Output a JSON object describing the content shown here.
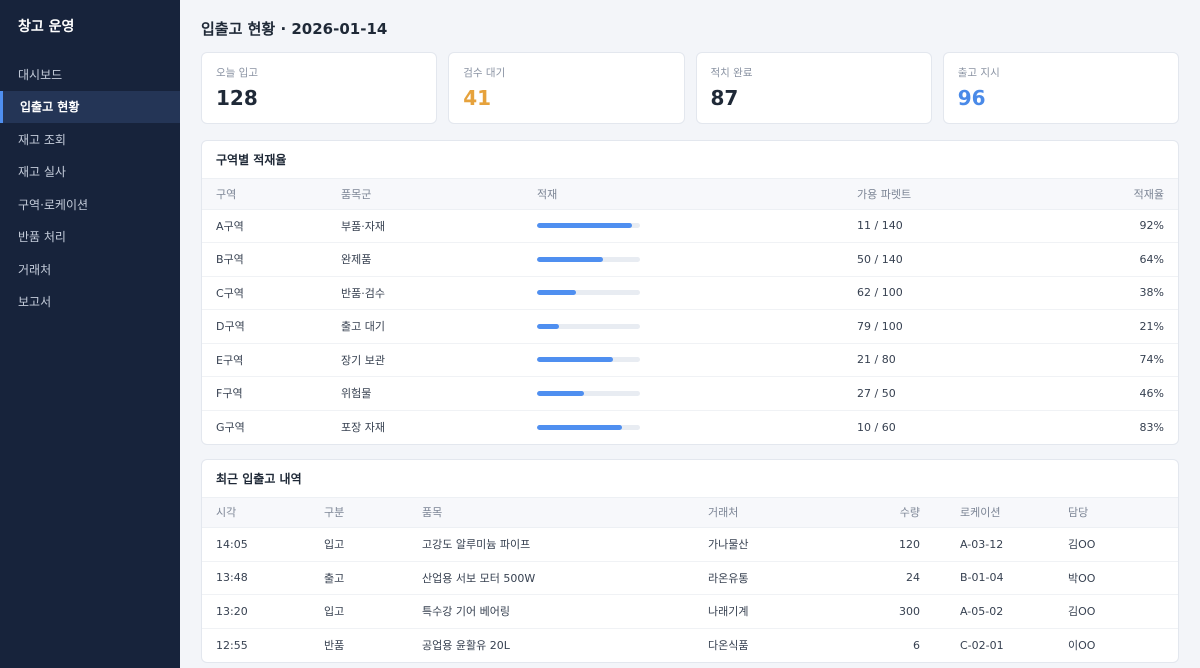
{
  "sidebar": {
    "title": "창고 운영",
    "items": [
      {
        "label": "대시보드",
        "active": false
      },
      {
        "label": "입출고 현황",
        "active": true
      },
      {
        "label": "재고 조회",
        "active": false
      },
      {
        "label": "재고 실사",
        "active": false
      },
      {
        "label": "구역·로케이션",
        "active": false
      },
      {
        "label": "반품 처리",
        "active": false
      },
      {
        "label": "거래처",
        "active": false
      },
      {
        "label": "보고서",
        "active": false
      }
    ]
  },
  "header": {
    "title": "입출고 현황 · 2026-01-14"
  },
  "cards": [
    {
      "label": "오늘 입고",
      "value": "128",
      "color": "#1f2937"
    },
    {
      "label": "검수 대기",
      "value": "41",
      "color": "#e6a23c"
    },
    {
      "label": "적치 완료",
      "value": "87",
      "color": "#1f2937"
    },
    {
      "label": "출고 지시",
      "value": "96",
      "color": "#4a8ae8"
    }
  ],
  "zones": {
    "title": "구역별 적재율",
    "columns": [
      "구역",
      "품목군",
      "적재",
      "가용 파렛트",
      "적재율"
    ],
    "rows": [
      {
        "zone": "A구역",
        "category": "부품·자재",
        "fill": 0.92,
        "pallets": "11 / 140",
        "rate": "92%"
      },
      {
        "zone": "B구역",
        "category": "완제품",
        "fill": 0.64,
        "pallets": "50 / 140",
        "rate": "64%"
      },
      {
        "zone": "C구역",
        "category": "반품·검수",
        "fill": 0.38,
        "pallets": "62 / 100",
        "rate": "38%"
      },
      {
        "zone": "D구역",
        "category": "출고 대기",
        "fill": 0.21,
        "pallets": "79 / 100",
        "rate": "21%"
      },
      {
        "zone": "E구역",
        "category": "장기 보관",
        "fill": 0.74,
        "pallets": "21 / 80",
        "rate": "74%"
      },
      {
        "zone": "F구역",
        "category": "위험물",
        "fill": 0.46,
        "pallets": "27 / 50",
        "rate": "46%"
      },
      {
        "zone": "G구역",
        "category": "포장 자재",
        "fill": 0.83,
        "pallets": "10 / 60",
        "rate": "83%"
      }
    ]
  },
  "recent": {
    "title": "최근 입출고 내역",
    "columns": [
      "시각",
      "구분",
      "품목",
      "거래처",
      "수량",
      "로케이션",
      "담당"
    ],
    "rows": [
      {
        "time": "14:05",
        "type": "입고",
        "item": "고강도 알루미늄 파이프",
        "vendor": "가나물산",
        "qty": "120",
        "location": "A-03-12",
        "owner": "김OO"
      },
      {
        "time": "13:48",
        "type": "출고",
        "item": "산업용 서보 모터 500W",
        "vendor": "라온유통",
        "qty": "24",
        "location": "B-01-04",
        "owner": "박OO"
      },
      {
        "time": "13:20",
        "type": "입고",
        "item": "특수강 기어 베어링",
        "vendor": "나래기계",
        "qty": "300",
        "location": "A-05-02",
        "owner": "김OO"
      },
      {
        "time": "12:55",
        "type": "반품",
        "item": "공업용 윤활유 20L",
        "vendor": "다온식품",
        "qty": "6",
        "location": "C-02-01",
        "owner": "이OO"
      }
    ]
  }
}
